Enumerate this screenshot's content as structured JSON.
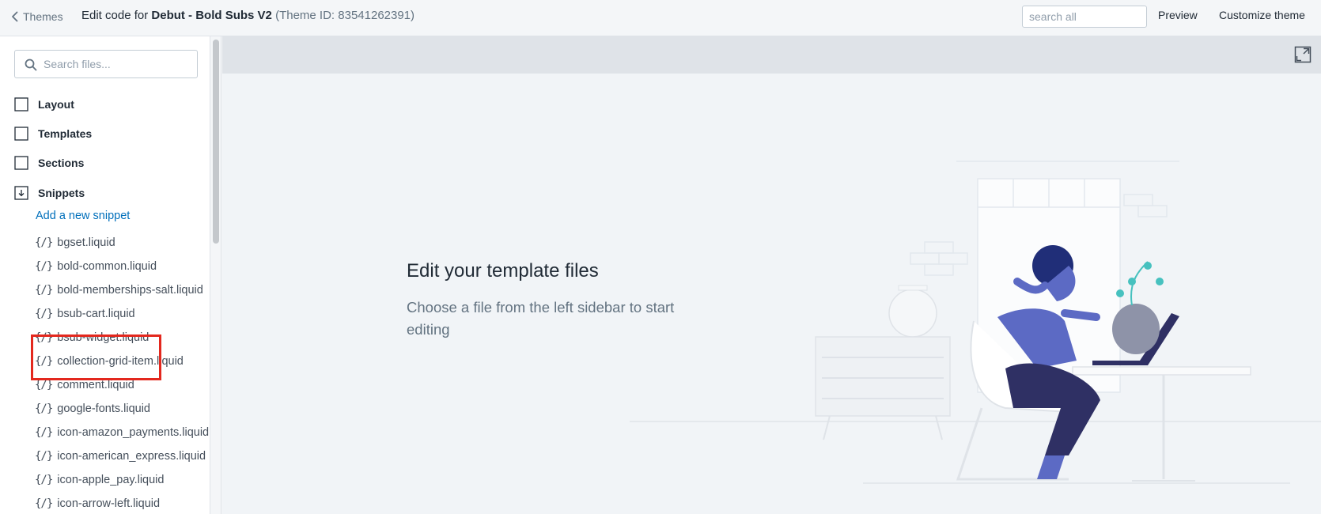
{
  "topbar": {
    "back_label": "Themes",
    "title_prefix": "Edit code for ",
    "theme_name": "Debut - Bold Subs V2",
    "theme_id": "(Theme ID: 83541262391)",
    "search_placeholder": "search all",
    "preview_label": "Preview",
    "customize_label": "Customize theme"
  },
  "sidebar": {
    "search_placeholder": "Search files...",
    "folders": {
      "layout": "Layout",
      "templates": "Templates",
      "sections": "Sections",
      "snippets": "Snippets"
    },
    "add_snippet_label": "Add a new snippet",
    "code_icon_glyph": "{/}",
    "files": [
      "bgset.liquid",
      "bold-common.liquid",
      "bold-memberships-salt.liquid",
      "bsub-cart.liquid",
      "bsub-widget.liquid",
      "collection-grid-item.liquid",
      "comment.liquid",
      "google-fonts.liquid",
      "icon-amazon_payments.liquid",
      "icon-american_express.liquid",
      "icon-apple_pay.liquid",
      "icon-arrow-left.liquid"
    ]
  },
  "main": {
    "empty_title": "Edit your template files",
    "empty_description": "Choose a file from the left sidebar to start editing"
  },
  "colors": {
    "link": "#006fbb",
    "highlight": "#e3281e",
    "illustration_primary": "#5c6ac4",
    "illustration_dark": "#2f3064"
  }
}
